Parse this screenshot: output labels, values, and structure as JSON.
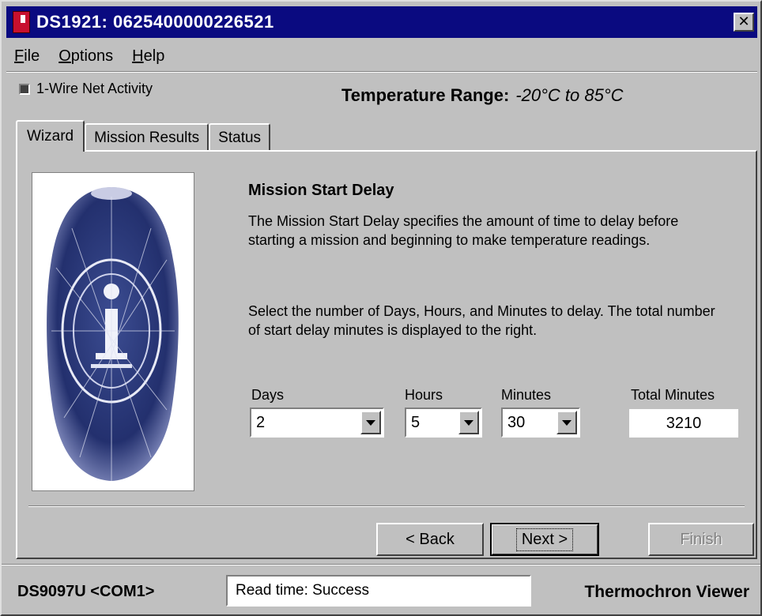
{
  "window": {
    "title": "DS1921:  0625400000226521",
    "close_glyph": "✕"
  },
  "menu": {
    "items": [
      {
        "label": "File",
        "mnemonic": "F",
        "rest": "ile"
      },
      {
        "label": "Options",
        "mnemonic": "O",
        "rest": "ptions"
      },
      {
        "label": "Help",
        "mnemonic": "H",
        "rest": "elp"
      }
    ]
  },
  "activity": {
    "label": "1-Wire Net Activity"
  },
  "temperature_range": {
    "label": "Temperature Range:",
    "value": "-20°C to 85°C"
  },
  "tabs": [
    {
      "label": "Wizard",
      "active": true
    },
    {
      "label": "Mission Results",
      "active": false
    },
    {
      "label": "Status",
      "active": false
    }
  ],
  "wizard": {
    "heading": "Mission Start Delay",
    "paragraph1": "The Mission Start Delay specifies the amount of time to delay before starting a mission and beginning to make temperature readings.",
    "paragraph2": "Select the number of Days, Hours, and Minutes to delay.  The total number of start delay minutes is displayed to the right.",
    "days": {
      "label": "Days",
      "value": "2"
    },
    "hours": {
      "label": "Hours",
      "value": "5"
    },
    "minutes": {
      "label": "Minutes",
      "value": "30"
    },
    "total": {
      "label": "Total Minutes",
      "value": "3210"
    }
  },
  "buttons": {
    "back": "< Back",
    "next": "Next >",
    "finish": "Finish"
  },
  "statusbar": {
    "port": "DS9097U <COM1>",
    "message": "Read time: Success",
    "app_name": "Thermochron Viewer"
  },
  "colors": {
    "titlebar": "#0a0a80",
    "face": "#c0c0c0",
    "icon_blue": "#2a3a7a"
  }
}
